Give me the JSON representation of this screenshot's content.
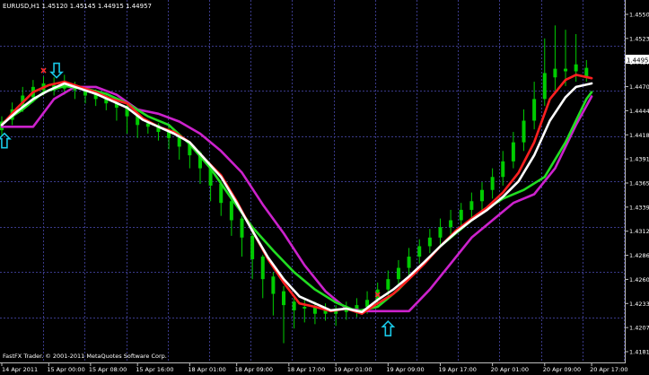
{
  "window": {
    "header": "EURUSD,H1  1.45120 1.45145 1.44915 1.44957",
    "footer": "FastFX Trader. © 2001-2011 MetaQuotes Software Corp."
  },
  "colors": {
    "background": "#000000",
    "grid": "#3a3a8a",
    "axis": "#bfbfbf",
    "text": "#ffffff",
    "candles": "#00cc00",
    "price_tag_bg": "#ffffff",
    "price_tag_text": "#000000",
    "arrow": "#19c8e6",
    "cross": "#ff2a2a"
  },
  "icons": {
    "buy": "cyan-up-arrow-icon",
    "sell": "cyan-down-arrow-icon",
    "signal": "red-x-icon"
  },
  "chart_data": {
    "type": "line",
    "symbol": "EURUSD",
    "timeframe": "H1",
    "ohlc": {
      "open": 1.4512,
      "high": 1.45145,
      "low": 1.44915,
      "close": 1.44957
    },
    "current_price_label": "1.44957",
    "ylim": [
      1.4172,
      1.4574
    ],
    "x_range": [
      0,
      119
    ],
    "y_ticks": [
      "1.45500",
      "1.45235",
      "1.44970",
      "1.44705",
      "1.44445",
      "1.44180",
      "1.43915",
      "1.43655",
      "1.43390",
      "1.43125",
      "1.42865",
      "1.42600",
      "1.42335",
      "1.42075",
      "1.41810"
    ],
    "x_ticks": [
      {
        "x": 0,
        "label": "14 Apr 2011"
      },
      {
        "x": 9,
        "label": "15 Apr 00:00"
      },
      {
        "x": 17,
        "label": "15 Apr 08:00"
      },
      {
        "x": 26,
        "label": "15 Apr 16:00"
      },
      {
        "x": 36,
        "label": "18 Apr 01:00"
      },
      {
        "x": 45,
        "label": "18 Apr 09:00"
      },
      {
        "x": 55,
        "label": "18 Apr 17:00"
      },
      {
        "x": 64,
        "label": "19 Apr 01:00"
      },
      {
        "x": 74,
        "label": "19 Apr 09:00"
      },
      {
        "x": 84,
        "label": "19 Apr 17:00"
      },
      {
        "x": 94,
        "label": "20 Apr 01:00"
      },
      {
        "x": 104,
        "label": "20 Apr 09:00"
      },
      {
        "x": 113,
        "label": "20 Apr 17:00"
      }
    ],
    "series": [
      {
        "color": "#cc22cc",
        "points": [
          [
            0,
            1.4438
          ],
          [
            6,
            1.4438
          ],
          [
            10,
            1.447
          ],
          [
            14,
            1.4484
          ],
          [
            18,
            1.4484
          ],
          [
            22,
            1.4475
          ],
          [
            26,
            1.4458
          ],
          [
            30,
            1.4453
          ],
          [
            34,
            1.4444
          ],
          [
            38,
            1.443
          ],
          [
            42,
            1.441
          ],
          [
            46,
            1.4385
          ],
          [
            50,
            1.4348
          ],
          [
            54,
            1.4315
          ],
          [
            58,
            1.4278
          ],
          [
            62,
            1.4248
          ],
          [
            66,
            1.4228
          ],
          [
            70,
            1.4225
          ],
          [
            74,
            1.4225
          ],
          [
            78,
            1.4225
          ],
          [
            82,
            1.425
          ],
          [
            86,
            1.428
          ],
          [
            90,
            1.431
          ],
          [
            94,
            1.433
          ],
          [
            98,
            1.435
          ],
          [
            102,
            1.436
          ],
          [
            106,
            1.439
          ],
          [
            110,
            1.444
          ],
          [
            113,
            1.4473
          ]
        ]
      },
      {
        "color": "#22dd22",
        "points": [
          [
            0,
            1.4442
          ],
          [
            4,
            1.4458
          ],
          [
            8,
            1.4478
          ],
          [
            12,
            1.4485
          ],
          [
            16,
            1.4482
          ],
          [
            20,
            1.4476
          ],
          [
            24,
            1.4465
          ],
          [
            28,
            1.445
          ],
          [
            32,
            1.444
          ],
          [
            36,
            1.4418
          ],
          [
            40,
            1.439
          ],
          [
            44,
            1.4355
          ],
          [
            48,
            1.4322
          ],
          [
            52,
            1.4295
          ],
          [
            56,
            1.427
          ],
          [
            60,
            1.425
          ],
          [
            64,
            1.4235
          ],
          [
            68,
            1.4225
          ],
          [
            72,
            1.423
          ],
          [
            76,
            1.425
          ],
          [
            80,
            1.4275
          ],
          [
            84,
            1.43
          ],
          [
            88,
            1.432
          ],
          [
            92,
            1.434
          ],
          [
            96,
            1.4355
          ],
          [
            100,
            1.4365
          ],
          [
            104,
            1.438
          ],
          [
            108,
            1.442
          ],
          [
            112,
            1.447
          ],
          [
            113,
            1.4478
          ]
        ]
      },
      {
        "color": "#ff2020",
        "points": [
          [
            0,
            1.444
          ],
          [
            3,
            1.446
          ],
          [
            6,
            1.4478
          ],
          [
            9,
            1.4486
          ],
          [
            12,
            1.449
          ],
          [
            15,
            1.4484
          ],
          [
            18,
            1.4478
          ],
          [
            21,
            1.447
          ],
          [
            24,
            1.4465
          ],
          [
            27,
            1.4448
          ],
          [
            30,
            1.4438
          ],
          [
            33,
            1.4432
          ],
          [
            36,
            1.442
          ],
          [
            39,
            1.44
          ],
          [
            42,
            1.4382
          ],
          [
            45,
            1.4352
          ],
          [
            48,
            1.4318
          ],
          [
            51,
            1.4285
          ],
          [
            54,
            1.4258
          ],
          [
            57,
            1.4234
          ],
          [
            60,
            1.423
          ],
          [
            63,
            1.4225
          ],
          [
            66,
            1.4228
          ],
          [
            69,
            1.4222
          ],
          [
            72,
            1.4234
          ],
          [
            75,
            1.4245
          ],
          [
            78,
            1.4262
          ],
          [
            81,
            1.428
          ],
          [
            84,
            1.43
          ],
          [
            87,
            1.4318
          ],
          [
            90,
            1.4332
          ],
          [
            93,
            1.4345
          ],
          [
            96,
            1.4362
          ],
          [
            99,
            1.4385
          ],
          [
            102,
            1.442
          ],
          [
            105,
            1.447
          ],
          [
            108,
            1.4492
          ],
          [
            110,
            1.4498
          ],
          [
            113,
            1.4494
          ]
        ]
      },
      {
        "color": "#ffffff",
        "points": [
          [
            0,
            1.444
          ],
          [
            3,
            1.4456
          ],
          [
            6,
            1.447
          ],
          [
            9,
            1.448
          ],
          [
            12,
            1.4488
          ],
          [
            15,
            1.4482
          ],
          [
            18,
            1.4476
          ],
          [
            21,
            1.4468
          ],
          [
            24,
            1.446
          ],
          [
            27,
            1.4446
          ],
          [
            30,
            1.4438
          ],
          [
            33,
            1.443
          ],
          [
            36,
            1.442
          ],
          [
            39,
            1.44
          ],
          [
            42,
            1.438
          ],
          [
            45,
            1.435
          ],
          [
            48,
            1.4318
          ],
          [
            51,
            1.4287
          ],
          [
            54,
            1.4262
          ],
          [
            57,
            1.4242
          ],
          [
            60,
            1.4234
          ],
          [
            63,
            1.4226
          ],
          [
            66,
            1.4228
          ],
          [
            69,
            1.4224
          ],
          [
            72,
            1.4238
          ],
          [
            75,
            1.425
          ],
          [
            78,
            1.4265
          ],
          [
            81,
            1.4282
          ],
          [
            84,
            1.43
          ],
          [
            87,
            1.4316
          ],
          [
            90,
            1.433
          ],
          [
            93,
            1.4342
          ],
          [
            96,
            1.4357
          ],
          [
            99,
            1.4375
          ],
          [
            102,
            1.4405
          ],
          [
            105,
            1.4445
          ],
          [
            108,
            1.4472
          ],
          [
            110,
            1.4484
          ],
          [
            113,
            1.4488
          ]
        ]
      }
    ],
    "candles": [
      [
        0,
        1.4444,
        1.4434,
        1.445,
        1.4428
      ],
      [
        2,
        1.4458,
        1.4446,
        1.4466,
        1.444
      ],
      [
        4,
        1.4474,
        1.446,
        1.4484,
        1.4455
      ],
      [
        6,
        1.4484,
        1.4472,
        1.4492,
        1.4466
      ],
      [
        8,
        1.4488,
        1.448,
        1.4496,
        1.4474
      ],
      [
        10,
        1.4486,
        1.448,
        1.4495,
        1.4474
      ],
      [
        12,
        1.449,
        1.4482,
        1.4498,
        1.4475
      ],
      [
        14,
        1.448,
        1.4486,
        1.449,
        1.447
      ],
      [
        16,
        1.4474,
        1.448,
        1.4484,
        1.4465
      ],
      [
        18,
        1.447,
        1.4476,
        1.4481,
        1.4462
      ],
      [
        20,
        1.4465,
        1.447,
        1.4475,
        1.4457
      ],
      [
        22,
        1.446,
        1.4466,
        1.4468,
        1.4445
      ],
      [
        24,
        1.445,
        1.4462,
        1.4466,
        1.443
      ],
      [
        26,
        1.444,
        1.4452,
        1.4455,
        1.4425
      ],
      [
        28,
        1.4438,
        1.4442,
        1.4446,
        1.443
      ],
      [
        30,
        1.4432,
        1.444,
        1.4442,
        1.4422
      ],
      [
        32,
        1.4425,
        1.4434,
        1.444,
        1.4412
      ],
      [
        34,
        1.4415,
        1.4427,
        1.443,
        1.44
      ],
      [
        36,
        1.4405,
        1.4418,
        1.442,
        1.439
      ],
      [
        38,
        1.439,
        1.4408,
        1.441,
        1.4372
      ],
      [
        40,
        1.437,
        1.4392,
        1.4395,
        1.4352
      ],
      [
        42,
        1.435,
        1.4372,
        1.4376,
        1.4335
      ],
      [
        44,
        1.433,
        1.4352,
        1.4355,
        1.4312
      ],
      [
        46,
        1.431,
        1.4332,
        1.4335,
        1.4288
      ],
      [
        48,
        1.4285,
        1.4312,
        1.4318,
        1.4262
      ],
      [
        50,
        1.4262,
        1.4288,
        1.429,
        1.424
      ],
      [
        52,
        1.4245,
        1.4265,
        1.427,
        1.422
      ],
      [
        54,
        1.4232,
        1.4248,
        1.4254,
        1.4188
      ],
      [
        56,
        1.4226,
        1.4236,
        1.4242,
        1.4205
      ],
      [
        58,
        1.4228,
        1.423,
        1.4238,
        1.4212
      ],
      [
        60,
        1.4222,
        1.423,
        1.4236,
        1.421
      ],
      [
        62,
        1.4226,
        1.4222,
        1.4234,
        1.4214
      ],
      [
        64,
        1.4222,
        1.4228,
        1.4232,
        1.4208
      ],
      [
        66,
        1.4228,
        1.4224,
        1.4236,
        1.4215
      ],
      [
        68,
        1.4232,
        1.4226,
        1.424,
        1.4218
      ],
      [
        70,
        1.4238,
        1.423,
        1.4248,
        1.4222
      ],
      [
        72,
        1.425,
        1.4238,
        1.4258,
        1.423
      ],
      [
        74,
        1.4262,
        1.425,
        1.4272,
        1.4242
      ],
      [
        76,
        1.4275,
        1.4262,
        1.4284,
        1.4255
      ],
      [
        78,
        1.4288,
        1.4275,
        1.4298,
        1.4266
      ],
      [
        80,
        1.43,
        1.4288,
        1.4308,
        1.428
      ],
      [
        82,
        1.431,
        1.43,
        1.432,
        1.4292
      ],
      [
        84,
        1.4322,
        1.431,
        1.4332,
        1.4302
      ],
      [
        86,
        1.433,
        1.4322,
        1.4342,
        1.4312
      ],
      [
        88,
        1.4342,
        1.433,
        1.435,
        1.432
      ],
      [
        90,
        1.4352,
        1.4342,
        1.4362,
        1.4332
      ],
      [
        92,
        1.4365,
        1.4352,
        1.4374,
        1.434
      ],
      [
        94,
        1.438,
        1.4365,
        1.439,
        1.4355
      ],
      [
        96,
        1.4398,
        1.438,
        1.441,
        1.437
      ],
      [
        98,
        1.442,
        1.4398,
        1.4432,
        1.439
      ],
      [
        100,
        1.4445,
        1.442,
        1.4458,
        1.441
      ],
      [
        102,
        1.447,
        1.4445,
        1.449,
        1.4435
      ],
      [
        104,
        1.45,
        1.447,
        1.454,
        1.4462
      ],
      [
        106,
        1.4505,
        1.4495,
        1.4555,
        1.448
      ],
      [
        108,
        1.4502,
        1.4505,
        1.455,
        1.4485
      ],
      [
        110,
        1.451,
        1.4502,
        1.4545,
        1.449
      ],
      [
        112,
        1.4496,
        1.4506,
        1.4515,
        1.449
      ]
    ],
    "signals": [
      {
        "type": "buy-arrow",
        "x": 0.5,
        "y": 1.4422
      },
      {
        "type": "sell-arrow",
        "x": 10.5,
        "y": 1.4503
      },
      {
        "type": "x-mark",
        "x": 8,
        "y": 1.4503
      },
      {
        "type": "buy-arrow",
        "x": 74,
        "y": 1.4205
      },
      {
        "type": "x-mark",
        "x": 72,
        "y": 1.4244
      }
    ]
  }
}
